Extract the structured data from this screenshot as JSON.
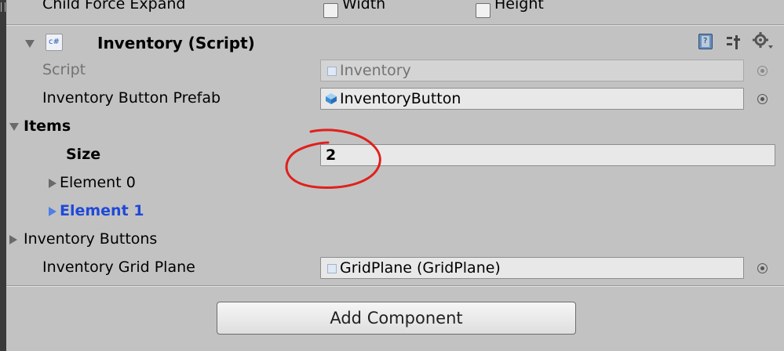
{
  "top_row": {
    "label": "Child Force Expand",
    "width_label": "Width",
    "height_label": "Height"
  },
  "component": {
    "title": "Inventory (Script)",
    "script_icon_text": "c#",
    "icons": [
      "help-book-icon",
      "preset-sliders-icon",
      "gear-icon"
    ]
  },
  "properties": {
    "script": {
      "label": "Script",
      "value": "Inventory"
    },
    "button_prefab": {
      "label": "Inventory Button Prefab",
      "value": "InventoryButton"
    },
    "items": {
      "label": "Items",
      "size_label": "Size",
      "size_value": "2",
      "elements": [
        "Element 0",
        "Element 1"
      ]
    },
    "inventory_buttons": {
      "label": "Inventory Buttons"
    },
    "grid_plane": {
      "label": "Inventory Grid Plane",
      "value": "GridPlane (GridPlane)"
    }
  },
  "add_component_label": "Add Component",
  "colors": {
    "panel_bg": "#c2c2c2",
    "selected_element": "#1f49d8",
    "annotation": "#e0201c"
  }
}
